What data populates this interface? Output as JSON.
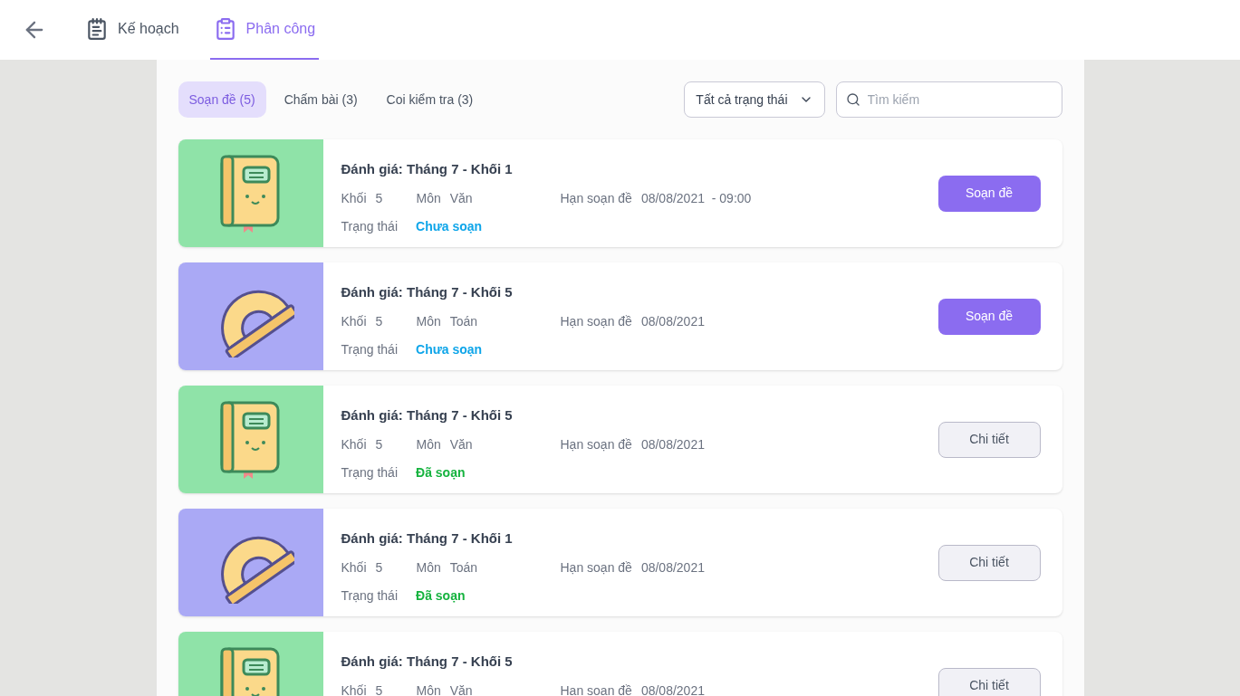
{
  "nav": {
    "tabs": [
      {
        "label": "Kế hoạch",
        "kind": "plan",
        "selected": false
      },
      {
        "label": "Phân công",
        "kind": "assign",
        "selected": true
      }
    ]
  },
  "filters": {
    "tabs": [
      {
        "label": "Soạn đề (5)",
        "selected": true
      },
      {
        "label": "Chấm bài (3)",
        "selected": false
      },
      {
        "label": "Coi kiểm tra (3)",
        "selected": false
      }
    ],
    "status_select": "Tất cả trạng thái",
    "search": {
      "placeholder": "Tìm kiếm"
    }
  },
  "cards": [
    {
      "kind": "book",
      "title": "Đánh giá: Tháng 7 - Khối 1",
      "fields": [
        {
          "label": "Khối",
          "value": "5"
        },
        {
          "label": "Môn",
          "value": "Văn"
        },
        {
          "label": "Hạn soạn đề",
          "value": "08/08/2021  - 09:00"
        }
      ],
      "status": {
        "label": "Trạng thái",
        "value": "Chưa soạn",
        "kind": "pending"
      },
      "action": {
        "label": "Soạn đề",
        "kind": "primary"
      }
    },
    {
      "kind": "protractor",
      "title": "Đánh giá: Tháng 7 - Khối 5",
      "fields": [
        {
          "label": "Khối",
          "value": "5"
        },
        {
          "label": "Môn",
          "value": "Toán"
        },
        {
          "label": "Hạn soạn đề",
          "value": "08/08/2021"
        }
      ],
      "status": {
        "label": "Trạng thái",
        "value": "Chưa soạn",
        "kind": "pending"
      },
      "action": {
        "label": "Soạn đề",
        "kind": "primary"
      }
    },
    {
      "kind": "book",
      "title": "Đánh giá: Tháng 7 - Khối 5",
      "fields": [
        {
          "label": "Khối",
          "value": "5"
        },
        {
          "label": "Môn",
          "value": "Văn"
        },
        {
          "label": "Hạn soạn đề",
          "value": "08/08/2021"
        }
      ],
      "status": {
        "label": "Trạng thái",
        "value": "Đã soạn",
        "kind": "done"
      },
      "action": {
        "label": "Chi tiết",
        "kind": "secondary"
      }
    },
    {
      "kind": "protractor",
      "title": "Đánh giá: Tháng 7 - Khối 1",
      "fields": [
        {
          "label": "Khối",
          "value": "5"
        },
        {
          "label": "Môn",
          "value": "Toán"
        },
        {
          "label": "Hạn soạn đề",
          "value": "08/08/2021"
        }
      ],
      "status": {
        "label": "Trạng thái",
        "value": "Đã soạn",
        "kind": "done"
      },
      "action": {
        "label": "Chi tiết",
        "kind": "secondary"
      }
    },
    {
      "kind": "book",
      "title": "Đánh giá: Tháng 7 - Khối 5",
      "fields": [
        {
          "label": "Khối",
          "value": "5"
        },
        {
          "label": "Môn",
          "value": "Văn"
        },
        {
          "label": "Hạn soạn đề",
          "value": "08/08/2021"
        }
      ],
      "action": {
        "label": "Chi tiết",
        "kind": "secondary"
      }
    }
  ]
}
